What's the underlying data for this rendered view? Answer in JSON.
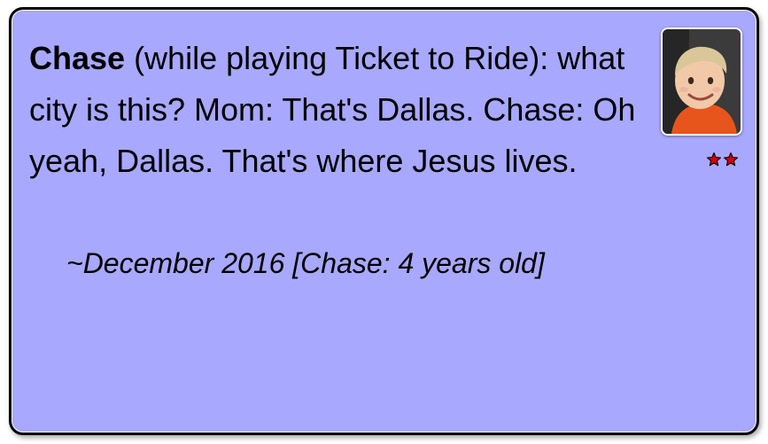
{
  "quote": {
    "speaker": "Chase",
    "text": " (while playing Ticket to Ride): what city is this? Mom: That's Dallas. Chase: Oh yeah, Dallas. That's where Jesus lives."
  },
  "attribution": "~December 2016 [Chase: 4 years old]",
  "photo": {
    "icon": "child-photo"
  },
  "rating": {
    "stars": 2,
    "icon": "star-icon",
    "color": "#d40000"
  },
  "colors": {
    "card_background": "#a8a8ff",
    "border": "#000000"
  }
}
